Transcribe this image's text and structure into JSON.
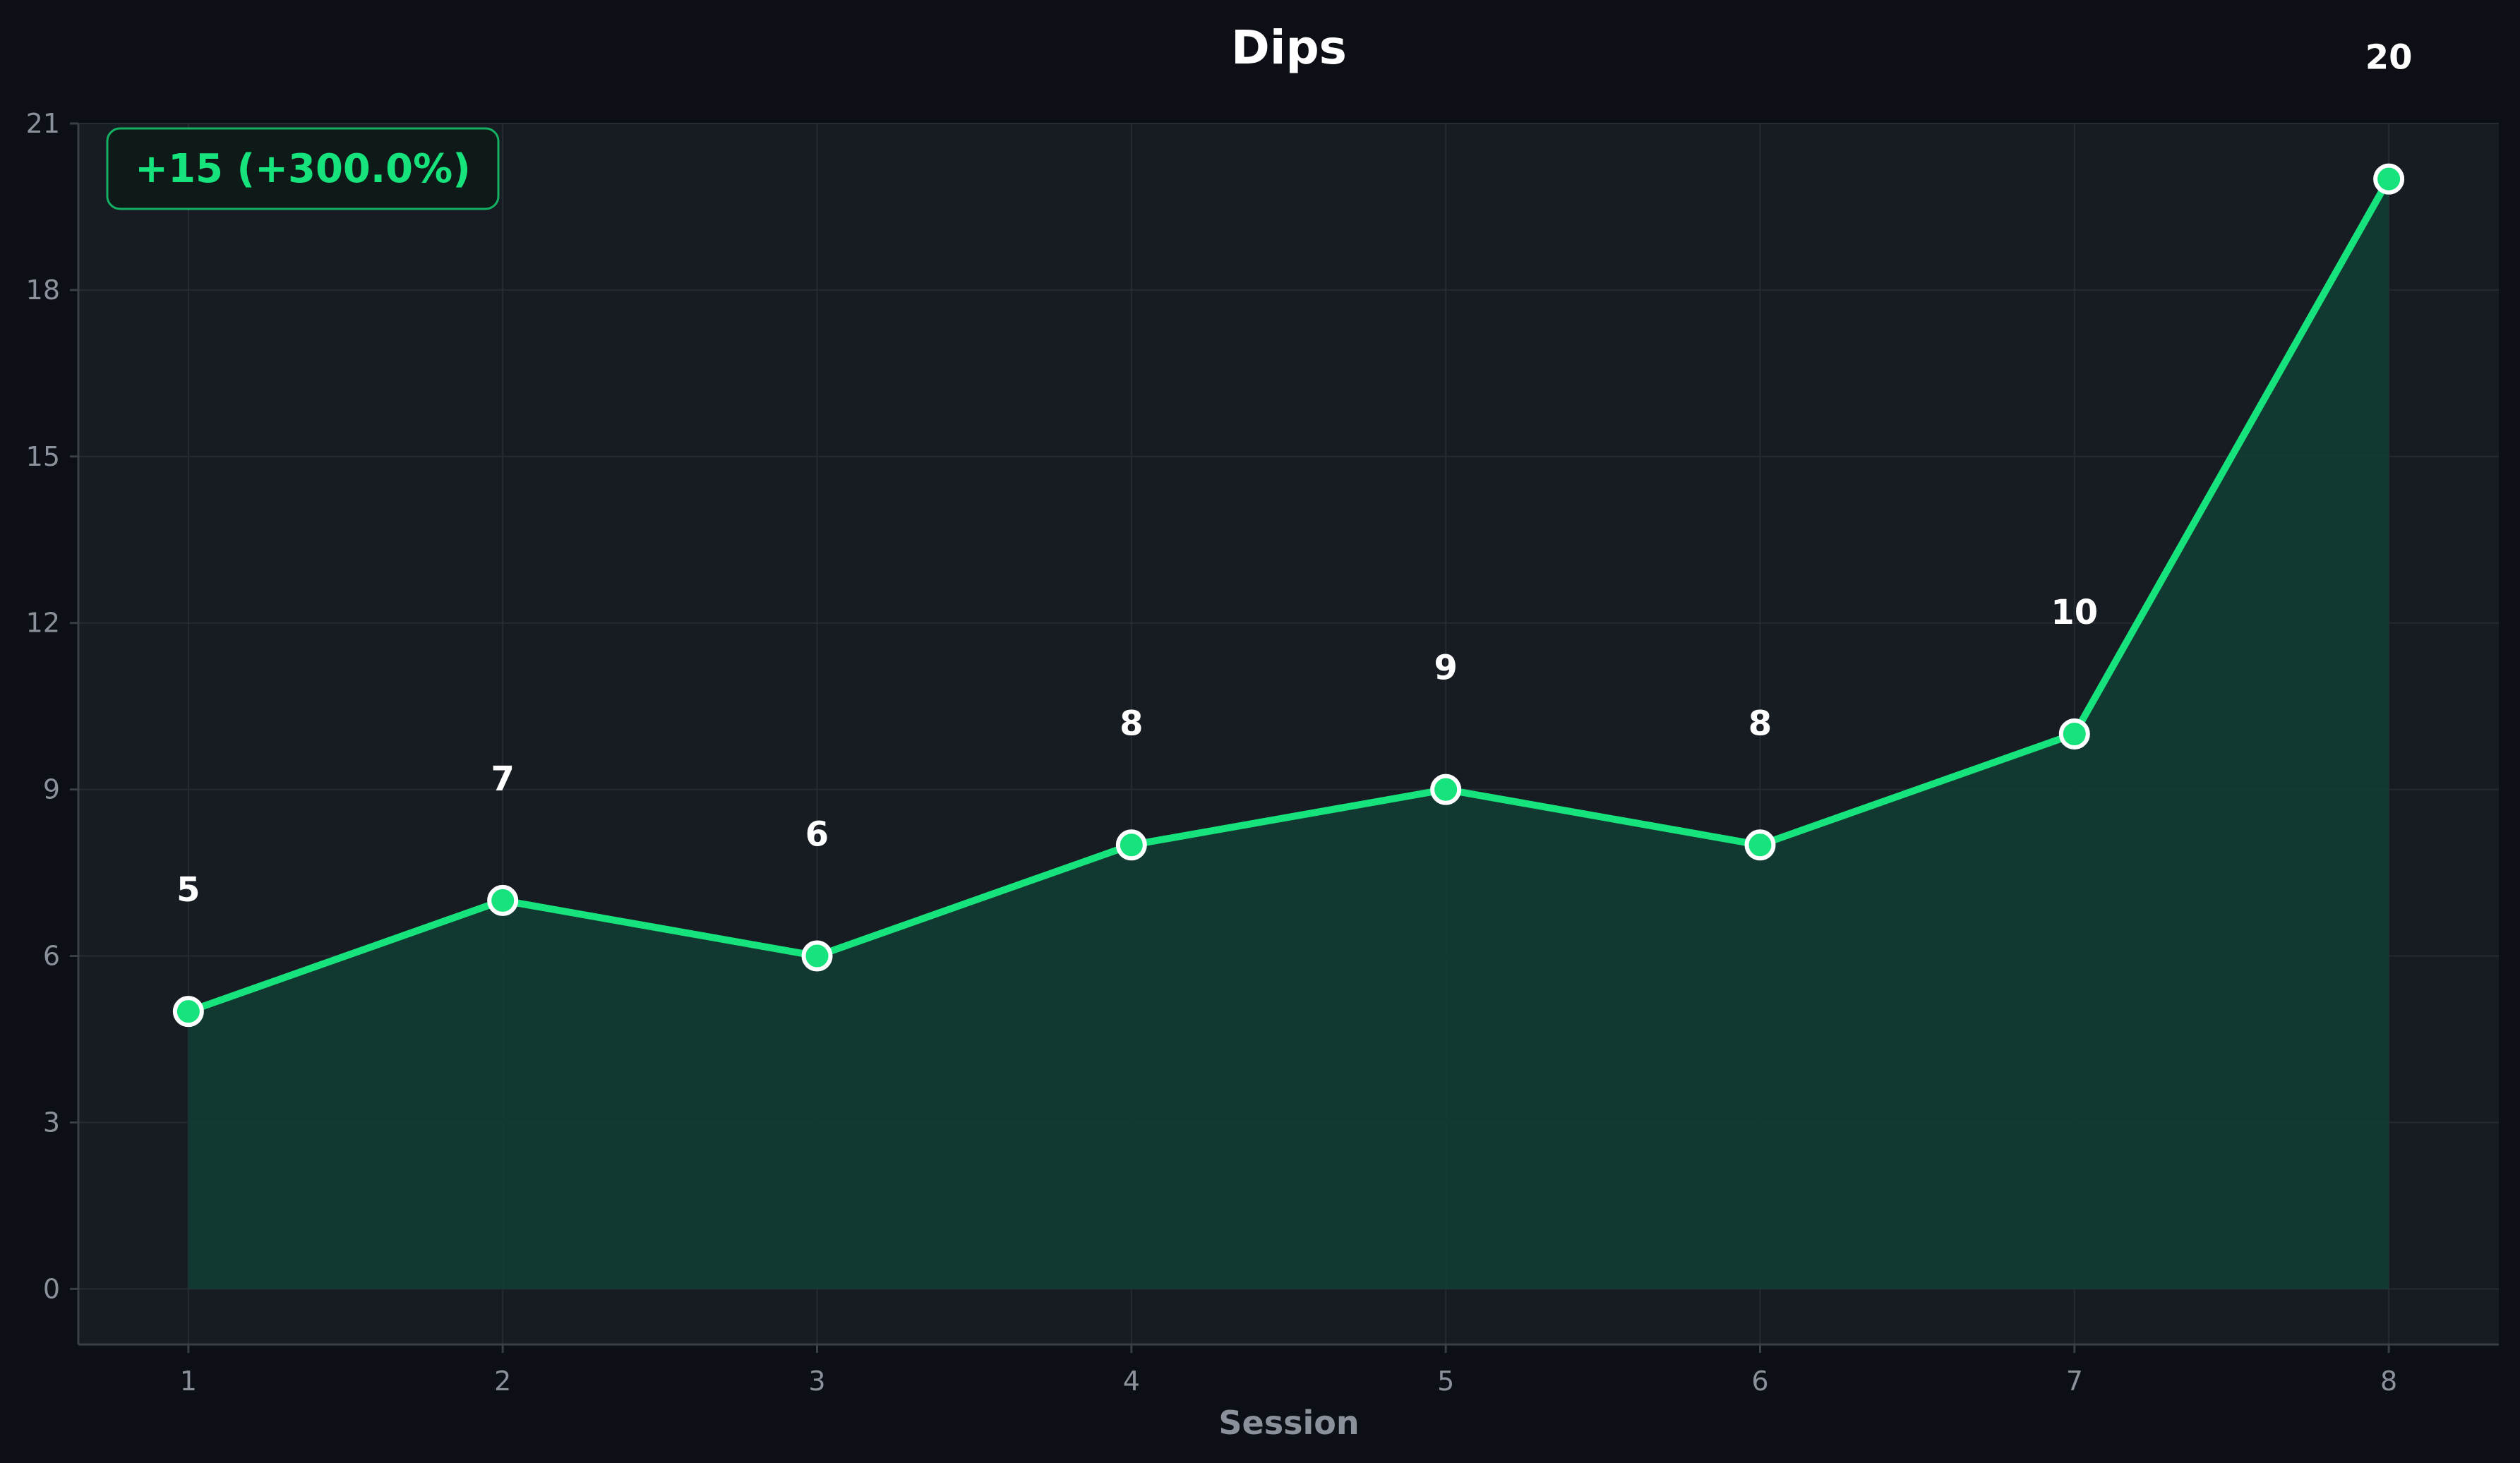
{
  "chart_data": {
    "type": "line",
    "title": "Dips",
    "xlabel": "Session",
    "ylabel": "",
    "x": [
      1,
      2,
      3,
      4,
      5,
      6,
      7,
      8
    ],
    "series": [
      {
        "values": [
          5,
          7,
          6,
          8,
          9,
          8,
          10,
          20
        ]
      }
    ],
    "xlim": [
      0.65,
      8.35
    ],
    "ylim": [
      -1,
      21
    ],
    "xticks": [
      "1",
      "2",
      "3",
      "4",
      "5",
      "6",
      "7",
      "8"
    ],
    "yticks": [
      "0",
      "3",
      "6",
      "9",
      "12",
      "15",
      "18",
      "21"
    ],
    "data_labels": [
      "5",
      "7",
      "6",
      "8",
      "9",
      "8",
      "10",
      "20"
    ],
    "change_annotation": "+15 (+300.0%)",
    "grid": true,
    "area_fill": true,
    "colors": {
      "line": "#17e37c",
      "area": "#123d33",
      "background": "#0c0f15",
      "plot_background": "#171b22",
      "grid": "#262b33",
      "ticks": "#8b919b",
      "text": "#ffffff"
    }
  }
}
